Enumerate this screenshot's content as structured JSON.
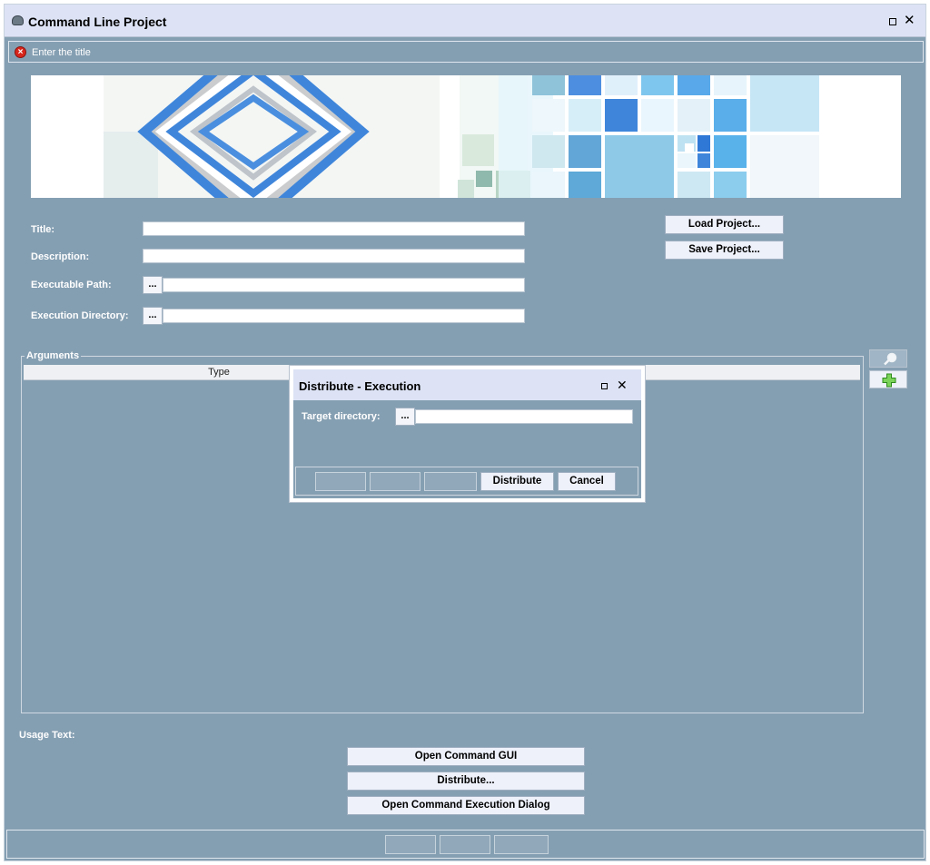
{
  "window": {
    "title": "Command Line Project"
  },
  "message": {
    "text": "Enter the title"
  },
  "form": {
    "title_label": "Title:",
    "title_value": "",
    "description_label": "Description:",
    "description_value": "",
    "exec_path_label": "Executable Path:",
    "exec_path_value": "",
    "exec_dir_label": "Execution Directory:",
    "exec_dir_value": "",
    "browse_label": "..."
  },
  "project_buttons": {
    "load": "Load Project...",
    "save": "Save Project..."
  },
  "arguments": {
    "legend": "Arguments",
    "columns": [
      "Type"
    ]
  },
  "usage": {
    "label": "Usage Text:"
  },
  "actions": {
    "open_gui": "Open Command GUI",
    "distribute": "Distribute...",
    "open_exec": "Open Command Execution Dialog"
  },
  "dialog": {
    "title": "Distribute - Execution",
    "target_label": "Target directory:",
    "target_value": "",
    "browse_label": "...",
    "distribute": "Distribute",
    "cancel": "Cancel"
  },
  "colors": {
    "background": "#859fb2",
    "titlebar": "#dde3f5",
    "error": "#d8261c",
    "add_icon": "#3fae2a"
  }
}
